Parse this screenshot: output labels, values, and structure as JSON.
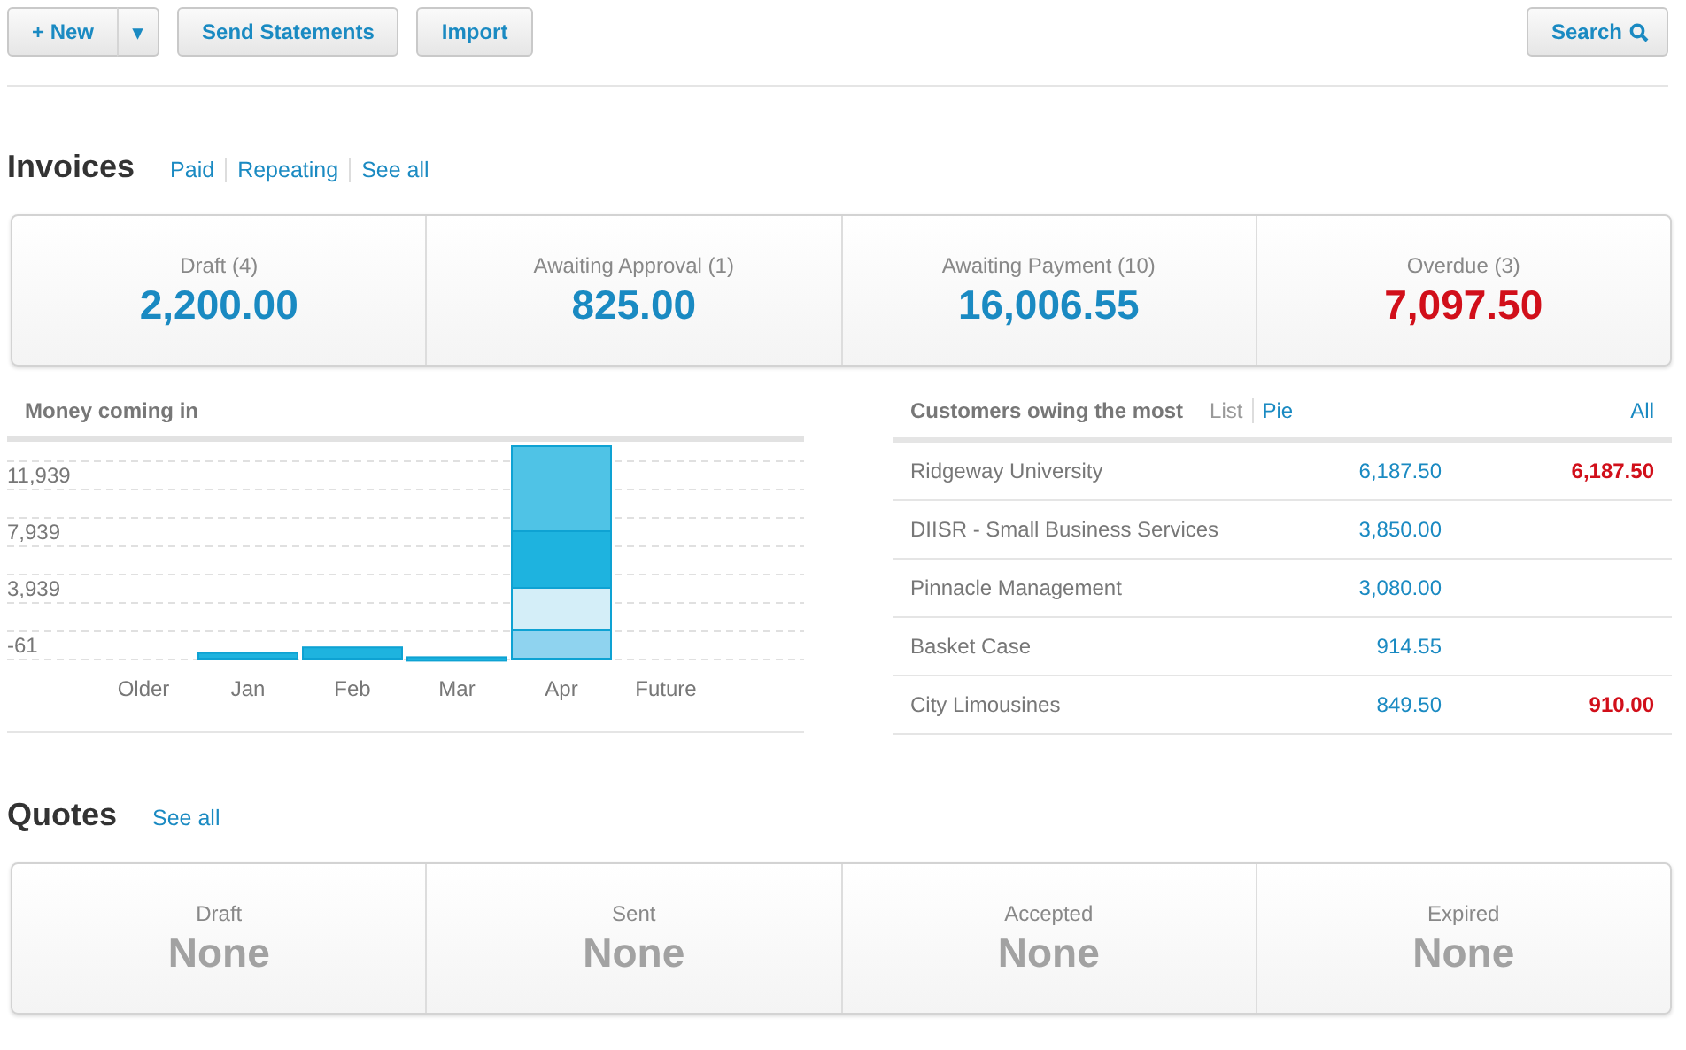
{
  "toolbar": {
    "new_button": "+ New",
    "dropdown_icon": "▾",
    "buttons": [
      "Send Statements",
      "Import"
    ],
    "search_button": "Search"
  },
  "invoices": {
    "title": "Invoices",
    "links": [
      "Paid",
      "Repeating",
      "See all"
    ],
    "summary": [
      {
        "label": "Draft (4)",
        "value": "2,200.00",
        "kind": "normal"
      },
      {
        "label": "Awaiting Approval (1)",
        "value": "825.00",
        "kind": "normal"
      },
      {
        "label": "Awaiting Payment (10)",
        "value": "16,006.55",
        "kind": "normal"
      },
      {
        "label": "Overdue (3)",
        "value": "7,097.50",
        "kind": "overdue"
      }
    ]
  },
  "money_coming_in": {
    "title": "Money coming in",
    "chart_data": {
      "type": "bar",
      "stacked": true,
      "categories": [
        "Older",
        "Jan",
        "Feb",
        "Mar",
        "Apr",
        "Future"
      ],
      "series": [
        {
          "color": "#1eb3df",
          "values": [
            null,
            400,
            800,
            100,
            null,
            null
          ]
        },
        {
          "color": "#8fd3ef",
          "values": [
            null,
            null,
            null,
            null,
            2000,
            null
          ]
        },
        {
          "color": "#d4eef8",
          "values": [
            null,
            null,
            null,
            null,
            3000,
            null
          ]
        },
        {
          "color": "#1eb3df",
          "values": [
            null,
            null,
            null,
            null,
            4000,
            null
          ]
        },
        {
          "color": "#4fc3e6",
          "values": [
            null,
            null,
            null,
            null,
            6000,
            null
          ]
        }
      ],
      "grid": true,
      "ylim": [
        -61,
        15439
      ],
      "yticks": [
        {
          "value": -61,
          "label": "-61"
        },
        {
          "value": 3939,
          "label": "3,939"
        },
        {
          "value": 7939,
          "label": "7,939"
        },
        {
          "value": 11939,
          "label": "11,939"
        }
      ]
    }
  },
  "customers": {
    "title": "Customers owing the most",
    "views": [
      {
        "label": "List",
        "selected": true
      },
      {
        "label": "Pie",
        "selected": false
      }
    ],
    "all_link": "All",
    "rows": [
      {
        "name": "Ridgeway University",
        "owing": "6,187.50",
        "overdue": "6,187.50"
      },
      {
        "name": "DIISR - Small Business Services",
        "owing": "3,850.00"
      },
      {
        "name": "Pinnacle Management",
        "owing": "3,080.00"
      },
      {
        "name": "Basket Case",
        "owing": "914.55"
      },
      {
        "name": "City Limousines",
        "owing": "849.50",
        "overdue": "910.00"
      }
    ]
  },
  "quotes": {
    "title": "Quotes",
    "links": [
      "See all"
    ],
    "summary": [
      {
        "label": "Draft",
        "value": "None"
      },
      {
        "label": "Sent",
        "value": "None"
      },
      {
        "label": "Accepted",
        "value": "None"
      },
      {
        "label": "Expired",
        "value": "None"
      }
    ]
  }
}
